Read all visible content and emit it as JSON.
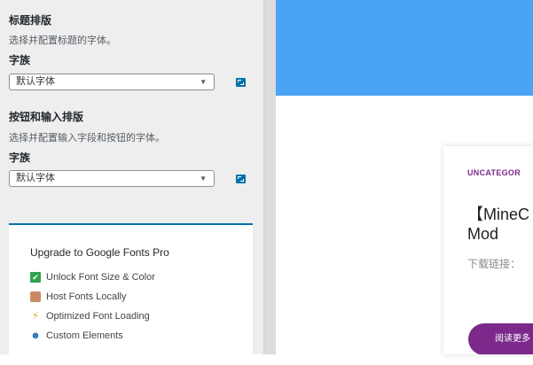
{
  "sidebar": {
    "heading_section": {
      "title": "标题排版",
      "description": "选择并配置标题的字体。",
      "field_label": "字族",
      "selected": "默认字体"
    },
    "input_section": {
      "title": "按钮和输入排版",
      "description": "选择并配置输入字段和按钮的字体。",
      "field_label": "字族",
      "selected": "默认字体"
    },
    "upgrade": {
      "title": "Upgrade to Google Fonts Pro",
      "features": [
        {
          "icon": "check-icon",
          "label": "Unlock Font Size & Color"
        },
        {
          "icon": "box-icon",
          "label": "Host Fonts Locally"
        },
        {
          "icon": "lightning-icon",
          "label": "Optimized Font Loading"
        },
        {
          "icon": "person-icon",
          "label": "Custom Elements"
        }
      ]
    }
  },
  "preview": {
    "category": "UNCATEGOR",
    "title_line1": "【MineC",
    "title_line2": "Mod",
    "excerpt": "下载链接：",
    "read_more": "阅读更多"
  },
  "colors": {
    "accent": "#0073aa",
    "hero": "#4aa3f5",
    "brand": "#7b2a8c"
  }
}
